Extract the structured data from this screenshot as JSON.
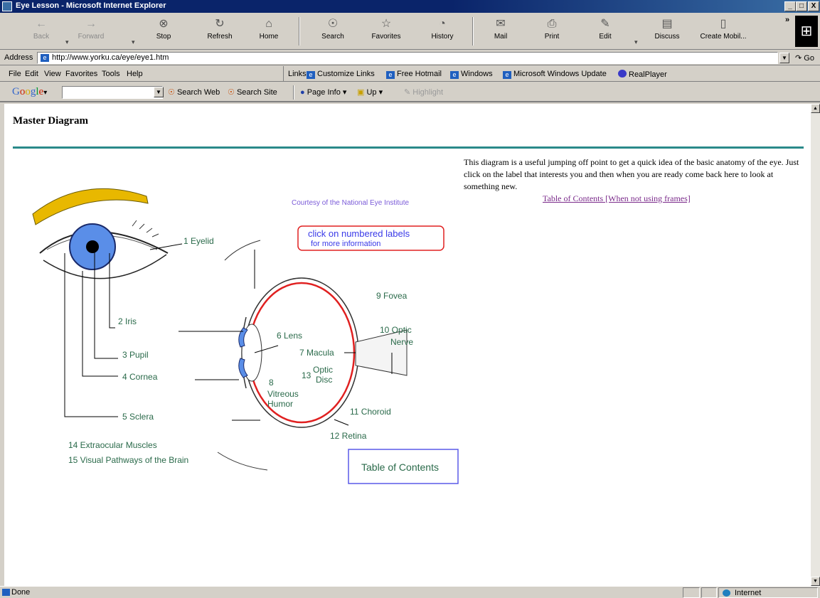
{
  "window": {
    "title": "Eye Lesson - Microsoft Internet Explorer",
    "min": "_",
    "max": "□",
    "close": "X"
  },
  "toolbar": {
    "back": "Back",
    "forward": "Forward",
    "stop": "Stop",
    "refresh": "Refresh",
    "home": "Home",
    "search": "Search",
    "favorites": "Favorites",
    "history": "History",
    "mail": "Mail",
    "print": "Print",
    "edit": "Edit",
    "discuss": "Discuss",
    "create_mobile": "Create Mobil...",
    "more": "»"
  },
  "address": {
    "label": "Address",
    "url": "http://www.yorku.ca/eye/eye1.htm",
    "go": "Go"
  },
  "menus": [
    "File",
    "Edit",
    "View",
    "Favorites",
    "Tools",
    "Help"
  ],
  "links": {
    "label": "Links",
    "items": [
      "Customize Links",
      "Free Hotmail",
      "Windows",
      "Microsoft Windows Update",
      "RealPlayer"
    ]
  },
  "google": {
    "logo": [
      "G",
      "o",
      "o",
      "g",
      "l",
      "e"
    ],
    "logo_suffix": "▾",
    "search_value": "",
    "search_web": "Search Web",
    "search_site": "Search Site",
    "page_info": "Page Info ▾",
    "up": "Up ▾",
    "highlight": "Highlight"
  },
  "page": {
    "title": "Master Diagram",
    "description": "This diagram is a useful jumping off point to get a quick idea of the basic anatomy of the eye. Just click on the label that interests you and then when you are ready come back here to look at something new.",
    "toc_link": "Table of Contents [When not using frames]"
  },
  "diagram": {
    "courtesy": "Courtesy of the National Eye Institute",
    "hint_line1": "click on numbered labels",
    "hint_line2": "for more information",
    "labels": {
      "eyelid": "1  Eyelid",
      "iris": "2  Iris",
      "pupil": "3  Pupil",
      "cornea": "4  Cornea",
      "sclera": "5    Sclera",
      "lens": "6 Lens",
      "macula": "7 Macula",
      "vitreous_num": "8",
      "vitreous_1": "Vitreous",
      "vitreous_2": "Humor",
      "fovea": "9  Fovea",
      "optic_nerve_1": "10  Optic",
      "optic_nerve_2": "Nerve",
      "choroid": "11 Choroid",
      "retina": "12  Retina",
      "optic_disc_num": "13",
      "optic_disc_1": "Optic",
      "optic_disc_2": "Disc",
      "extraocular": "14 Extraocular Muscles",
      "pathways": "15 Visual Pathways of the Brain"
    },
    "toc_button": "Table of Contents",
    "colors": {
      "eyebrow": "#e8b800",
      "iris": "#5a8ee8",
      "retina": "#e02020",
      "labels": "#2a6a4a",
      "courtesy": "#7a5ad8",
      "hint": "#3a3ae8"
    }
  },
  "status": {
    "text": "Done",
    "zone": "Internet"
  }
}
